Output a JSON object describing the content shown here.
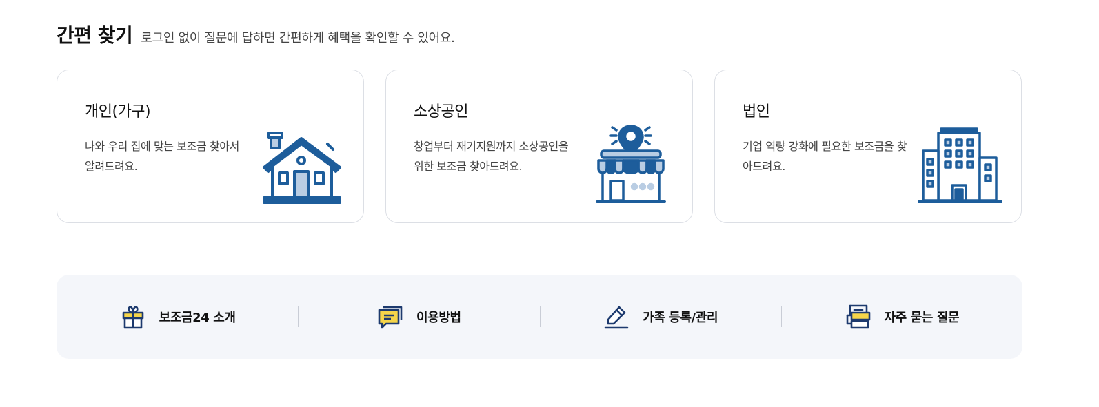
{
  "section": {
    "title": "간편 찾기",
    "subtitle": "로그인 없이 질문에 답하면 간편하게 혜택을 확인할 수 있어요."
  },
  "cards": [
    {
      "title": "개인(가구)",
      "desc": "나와 우리 집에 맞는 보조금 찾아서 알려드려요.",
      "icon": "house-icon"
    },
    {
      "title": "소상공인",
      "desc": "창업부터 재기지원까지 소상공인을 위한 보조금 찾아드려요.",
      "icon": "storefront-icon"
    },
    {
      "title": "법인",
      "desc": "기업 역량 강화에 필요한 보조금을 찾아드려요.",
      "icon": "office-building-icon"
    }
  ],
  "quicklinks": [
    {
      "label": "보조금24 소개",
      "icon": "gift-icon"
    },
    {
      "label": "이용방법",
      "icon": "chat-icon"
    },
    {
      "label": "가족 등록/관리",
      "icon": "pencil-icon"
    },
    {
      "label": "자주 묻는 질문",
      "icon": "faq-icon"
    }
  ],
  "colors": {
    "icon_blue": "#1d5d9b",
    "icon_light": "#b9cde3",
    "accent_yellow": "#f5d54a",
    "quickbar_bg": "#f4f6fa",
    "card_border": "#dcdfe5"
  }
}
